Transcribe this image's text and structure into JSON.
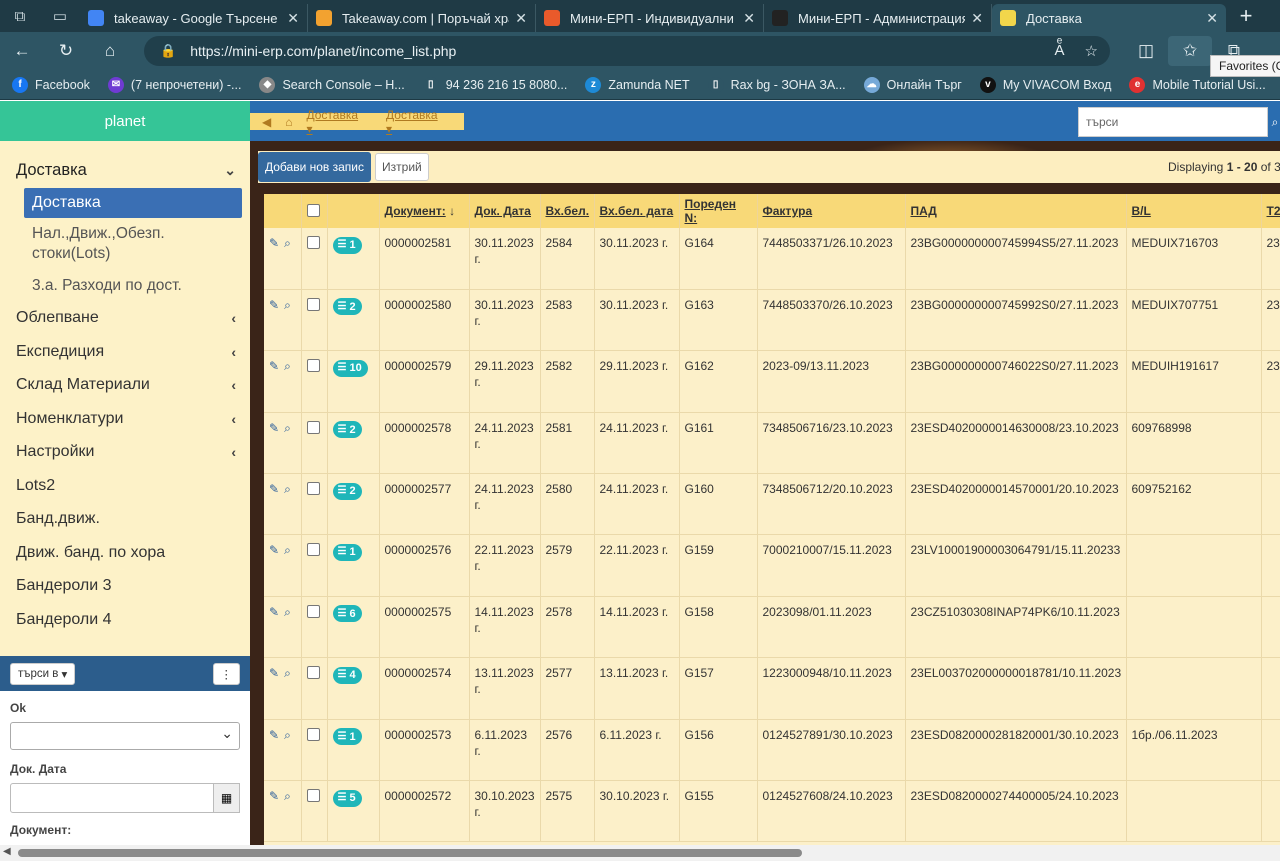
{
  "browser": {
    "tabs": [
      {
        "label": "takeaway - Google Търсене",
        "icon": "google-icon",
        "color": "#4285f4"
      },
      {
        "label": "Takeaway.com | Поръчай хран",
        "icon": "house-icon",
        "color": "#f2a230"
      },
      {
        "label": "Мини-ЕРП - Индивидуални р",
        "icon": "joomla-icon",
        "color": "#e95a2b"
      },
      {
        "label": "Мини-ЕРП - Администрация",
        "icon": "joomla-icon",
        "color": "#222222"
      },
      {
        "label": "Доставка",
        "icon": "planet-icon",
        "color": "#f2d64b",
        "active": true
      }
    ],
    "url": "https://mini-erp.com/planet/income_list.php",
    "tooltip": "Favorites (C",
    "bookmarks": [
      {
        "label": "Facebook",
        "color": "#1877f2",
        "glyph": "f"
      },
      {
        "label": "(7 непрочетени) -...",
        "color": "#6f3bd3",
        "glyph": "✉"
      },
      {
        "label": "Search Console – H...",
        "color": "#888888",
        "glyph": "◆"
      },
      {
        "label": "94 236 216 15 8080...",
        "color": "#2e5564",
        "glyph": "▯"
      },
      {
        "label": "Zamunda NET",
        "color": "#1e8ad6",
        "glyph": "z"
      },
      {
        "label": "Rax bg - ЗОНА ЗА...",
        "color": "#2e5564",
        "glyph": "▯"
      },
      {
        "label": "Онлайн Търг",
        "color": "#76a9d8",
        "glyph": "☁"
      },
      {
        "label": "My VIVACOM Вход",
        "color": "#111111",
        "glyph": "v"
      },
      {
        "label": "Mobile Tutorial Usi...",
        "color": "#e03131",
        "glyph": "e"
      }
    ]
  },
  "app": {
    "brand": "planet",
    "menu": {
      "open_section": "Доставка",
      "active_sub": "Доставка",
      "subs": [
        "Нал.,Движ.,Обезп. стоки(Lots)",
        "3.а. Разходи по дост."
      ],
      "sections": [
        {
          "label": "Облепване",
          "chevron": true
        },
        {
          "label": "Експедиция",
          "chevron": true
        },
        {
          "label": "Склад Материали",
          "chevron": true
        },
        {
          "label": "Номенклатури",
          "chevron": true
        },
        {
          "label": "Настройки",
          "chevron": true
        },
        {
          "label": "Lots2",
          "chevron": false
        },
        {
          "label": "Банд.движ.",
          "chevron": false
        },
        {
          "label": "Движ. банд. по хора",
          "chevron": false
        },
        {
          "label": "Бандероли 3",
          "chevron": false
        },
        {
          "label": "Бандероли 4",
          "chevron": false
        }
      ]
    },
    "filter": {
      "search_in": "търси в",
      "kebab": "⋮",
      "ok_label": "Ok",
      "doc_date_label": "Док. Дата",
      "document_label": "Документ:"
    },
    "breadcrumbs": [
      "Доставка",
      "Доставка"
    ],
    "search_placeholder": "търси",
    "toolbar": {
      "add_label": "Добави нов запис",
      "delete_label": "Изтрий",
      "displaying_prefix": "Displaying ",
      "displaying_range": "1 - 20",
      "displaying_suffix": " of 3"
    },
    "columns": [
      "Документ:",
      "Док. Дата",
      "Вх.бел.",
      "Вх.бел. дата",
      "Пореден N:",
      "Фактура",
      "ПАД",
      "B/L",
      "T2"
    ],
    "rows": [
      {
        "count": "1",
        "doc": "0000002581",
        "date": "30.11.2023 г.",
        "vh": "2584",
        "vhdate": "30.11.2023 г.",
        "seq": "G164",
        "invoice": "7448503371/26.10.2023",
        "pad": "23BG000000000745994S5/27.11.2023",
        "bl": "MEDUIX716703",
        "t2": "23"
      },
      {
        "count": "2",
        "doc": "0000002580",
        "date": "30.11.2023 г.",
        "vh": "2583",
        "vhdate": "30.11.2023 г.",
        "seq": "G163",
        "invoice": "7448503370/26.10.2023",
        "pad": "23BG000000000745992S0/27.11.2023",
        "bl": "MEDUIX707751",
        "t2": "23"
      },
      {
        "count": "10",
        "doc": "0000002579",
        "date": "29.11.2023 г.",
        "vh": "2582",
        "vhdate": "29.11.2023 г.",
        "seq": "G162",
        "invoice": "2023-09/13.11.2023",
        "pad": "23BG000000000746022S0/27.11.2023",
        "bl": "MEDUIH191617",
        "t2": "23"
      },
      {
        "count": "2",
        "doc": "0000002578",
        "date": "24.11.2023 г.",
        "vh": "2581",
        "vhdate": "24.11.2023 г.",
        "seq": "G161",
        "invoice": "7348506716/23.10.2023",
        "pad": "23ESD4020000014630008/23.10.2023",
        "bl": "609768998",
        "t2": ""
      },
      {
        "count": "2",
        "doc": "0000002577",
        "date": "24.11.2023 г.",
        "vh": "2580",
        "vhdate": "24.11.2023 г.",
        "seq": "G160",
        "invoice": "7348506712/20.10.2023",
        "pad": "23ESD4020000014570001/20.10.2023",
        "bl": "609752162",
        "t2": ""
      },
      {
        "count": "1",
        "doc": "0000002576",
        "date": "22.11.2023 г.",
        "vh": "2579",
        "vhdate": "22.11.2023 г.",
        "seq": "G159",
        "invoice": "7000210007/15.11.2023",
        "pad": "23LV10001900003064791/15.11.20233",
        "bl": "",
        "t2": ""
      },
      {
        "count": "6",
        "doc": "0000002575",
        "date": "14.11.2023 г.",
        "vh": "2578",
        "vhdate": "14.11.2023 г.",
        "seq": "G158",
        "invoice": "2023098/01.11.2023",
        "pad": "23CZ51030308INAP74PK6/10.11.2023",
        "bl": "",
        "t2": ""
      },
      {
        "count": "4",
        "doc": "0000002574",
        "date": "13.11.2023 г.",
        "vh": "2577",
        "vhdate": "13.11.2023 г.",
        "seq": "G157",
        "invoice": "1223000948/10.11.2023",
        "pad": "23EL003702000000018781/10.11.2023",
        "bl": "",
        "t2": ""
      },
      {
        "count": "1",
        "doc": "0000002573",
        "date": "6.11.2023 г.",
        "vh": "2576",
        "vhdate": "6.11.2023 г.",
        "seq": "G156",
        "invoice": "0124527891/30.10.2023",
        "pad": "23ESD0820000281820001/30.10.2023",
        "bl": "1бр./06.11.2023",
        "t2": ""
      },
      {
        "count": "5",
        "doc": "0000002572",
        "date": "30.10.2023 г.",
        "vh": "2575",
        "vhdate": "30.10.2023 г.",
        "seq": "G155",
        "invoice": "0124527608/24.10.2023",
        "pad": "23ESD0820000274400005/24.10.2023",
        "bl": "",
        "t2": ""
      }
    ]
  }
}
